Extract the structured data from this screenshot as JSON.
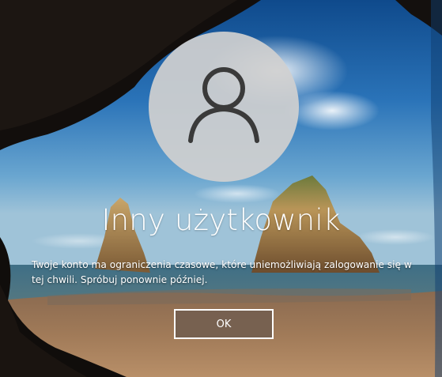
{
  "lock_screen": {
    "avatar_icon": "user-silhouette-icon",
    "username": "Inny użytkownik",
    "message": "Twoje konto ma ograniczenia czasowe, które uniemożliwiają zalogowanie się w tej chwili. Spróbuj ponownie później.",
    "ok_label": "OK"
  },
  "colors": {
    "text": "#ffffff",
    "button_fill": "#766050",
    "button_border": "#ffffff",
    "avatar_fill": "#d0d0d0",
    "avatar_icon": "#3a3a3a"
  }
}
